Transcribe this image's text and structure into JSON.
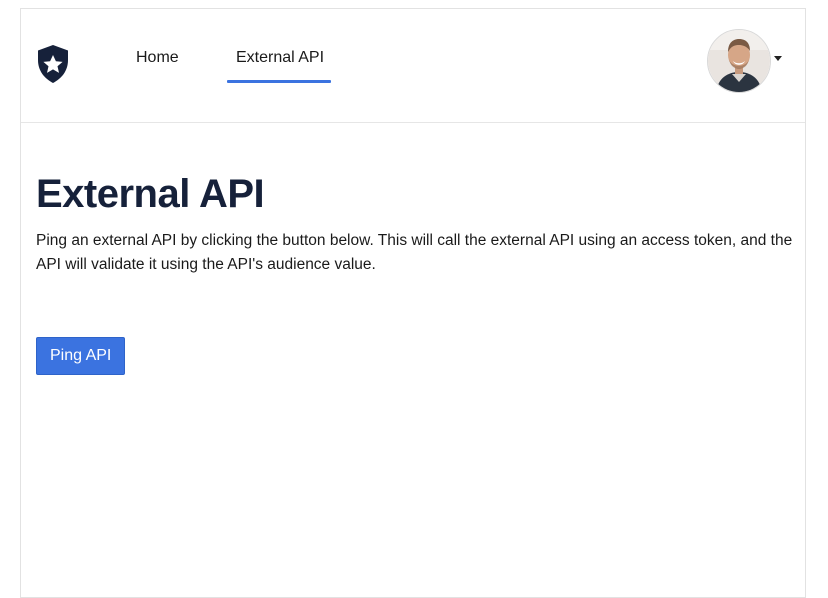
{
  "nav": {
    "items": [
      {
        "label": "Home",
        "active": false
      },
      {
        "label": "External API",
        "active": true
      }
    ],
    "accent_color": "#3b73e0",
    "logo_icon": "auth0-star-shield-icon",
    "avatar_icon": "user-avatar-photo",
    "menu_icon": "caret-down-icon"
  },
  "main": {
    "title": "External API",
    "description": "Ping an external API by clicking the button below. This will call the external API using an access token, and the API will validate it using the API's audience value.",
    "button_label": "Ping API"
  },
  "colors": {
    "title": "#16213a",
    "button": "#3b73e0"
  }
}
